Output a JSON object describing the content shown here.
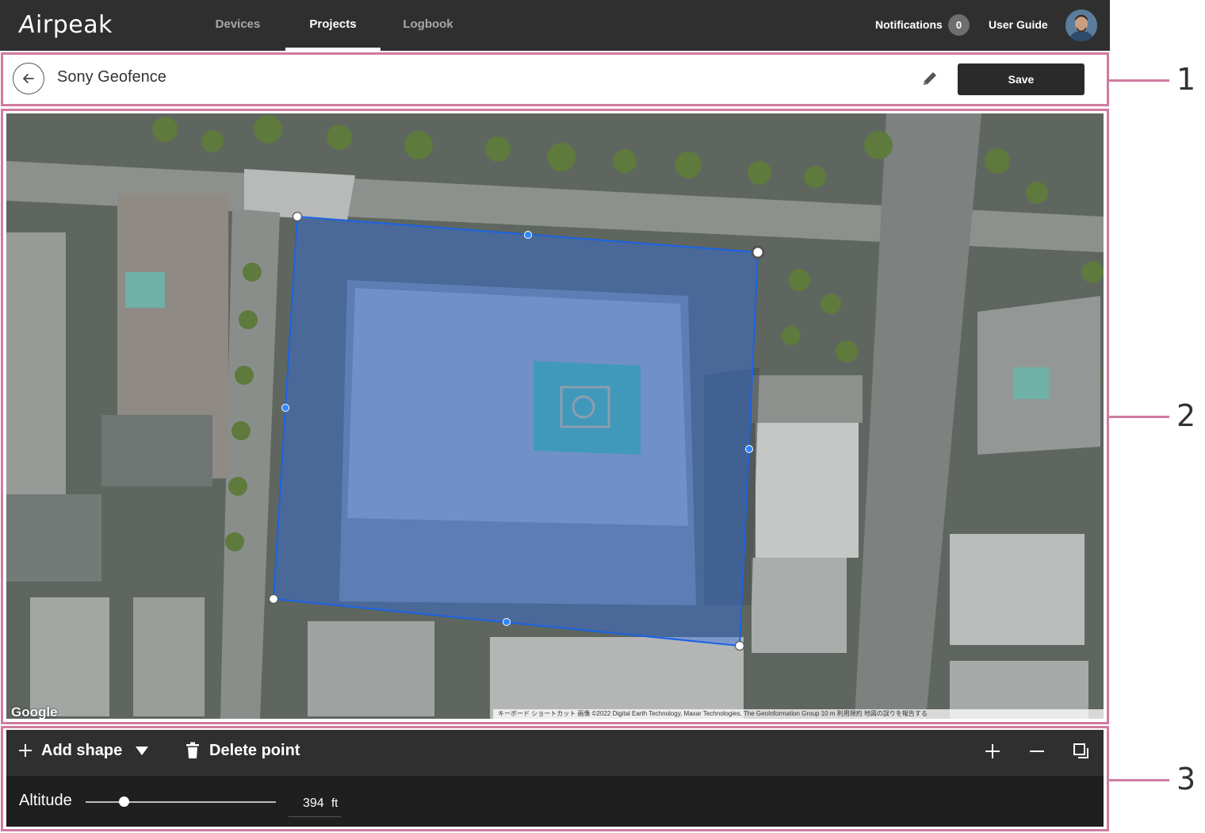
{
  "app": {
    "logo_text": "irpeak",
    "logo_initial": "A"
  },
  "nav": {
    "tabs": [
      {
        "label": "Devices",
        "active": false
      },
      {
        "label": "Projects",
        "active": true
      },
      {
        "label": "Logbook",
        "active": false
      }
    ],
    "notifications_label": "Notifications",
    "notifications_count": "0",
    "user_guide_label": "User Guide"
  },
  "header": {
    "title": "Sony Geofence",
    "save_label": "Save"
  },
  "map": {
    "provider_label": "Google",
    "attribution": "キーボード ショートカット   画像 ©2022 Digital Earth Technology, Maxar Technologies, The GeoInformation Group   10 m   利用規約   地図の誤りを報告する",
    "geofence_color": "#1a63e6"
  },
  "toolbar": {
    "add_shape_label": "Add shape",
    "delete_point_label": "Delete point",
    "altitude_label": "Altitude",
    "altitude_value": "394",
    "altitude_unit": "ft",
    "altitude_fraction": 0.2
  },
  "callouts": [
    "1",
    "2",
    "3"
  ],
  "colors": {
    "accent": "#d07ba0",
    "topbar": "#2f2f2f",
    "button": "#2a2a2a"
  }
}
